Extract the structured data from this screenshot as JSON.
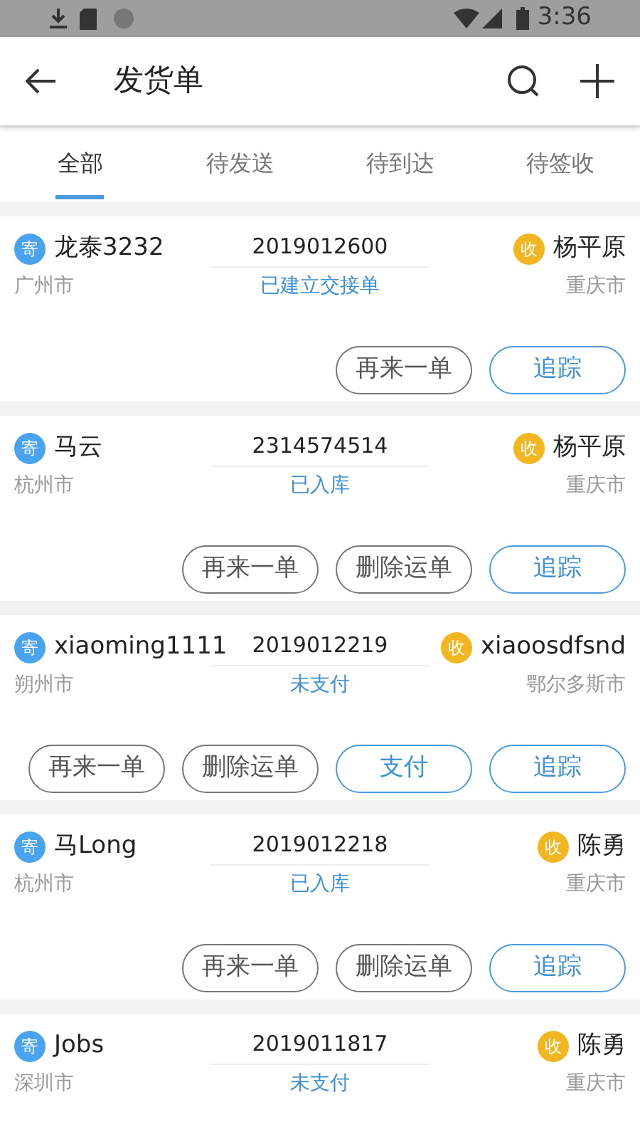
{
  "status_bar": {
    "time": "3:36"
  },
  "header": {
    "title": "发货单"
  },
  "tabs": [
    {
      "label": "全部",
      "selected": true
    },
    {
      "label": "待发送",
      "selected": false
    },
    {
      "label": "待到达",
      "selected": false
    },
    {
      "label": "待签收",
      "selected": false
    }
  ],
  "orders": [
    {
      "sender_badge": "寄",
      "sender": "龙泰3232",
      "sender_city": "广州市",
      "number": "2019012600",
      "status": "已建立交接单",
      "receiver_badge": "收",
      "receiver": "杨平原",
      "receiver_city": "重庆市",
      "buttons": [
        {
          "label": "再来一单",
          "kind": "plain"
        },
        {
          "label": "追踪",
          "kind": "primary"
        }
      ]
    },
    {
      "sender_badge": "寄",
      "sender": "马云",
      "sender_city": "杭州市",
      "number": "2314574514",
      "status": "已入库",
      "receiver_badge": "收",
      "receiver": "杨平原",
      "receiver_city": "重庆市",
      "buttons": [
        {
          "label": "再来一单",
          "kind": "plain"
        },
        {
          "label": "删除运单",
          "kind": "plain"
        },
        {
          "label": "追踪",
          "kind": "primary"
        }
      ]
    },
    {
      "sender_badge": "寄",
      "sender": "xiaoming1111",
      "sender_city": "朔州市",
      "number": "2019012219",
      "status": "未支付",
      "receiver_badge": "收",
      "receiver": "xiaoosdfsnd",
      "receiver_city": "鄂尔多斯市",
      "buttons": [
        {
          "label": "再来一单",
          "kind": "plain"
        },
        {
          "label": "删除运单",
          "kind": "plain"
        },
        {
          "label": "支付",
          "kind": "primary"
        },
        {
          "label": "追踪",
          "kind": "primary"
        }
      ]
    },
    {
      "sender_badge": "寄",
      "sender": "马Long",
      "sender_city": "杭州市",
      "number": "2019012218",
      "status": "已入库",
      "receiver_badge": "收",
      "receiver": "陈勇",
      "receiver_city": "重庆市",
      "buttons": [
        {
          "label": "再来一单",
          "kind": "plain"
        },
        {
          "label": "删除运单",
          "kind": "plain"
        },
        {
          "label": "追踪",
          "kind": "primary"
        }
      ]
    },
    {
      "sender_badge": "寄",
      "sender": "Jobs",
      "sender_city": "深圳市",
      "number": "2019011817",
      "status": "未支付",
      "receiver_badge": "收",
      "receiver": "陈勇",
      "receiver_city": "重庆市"
    }
  ]
}
